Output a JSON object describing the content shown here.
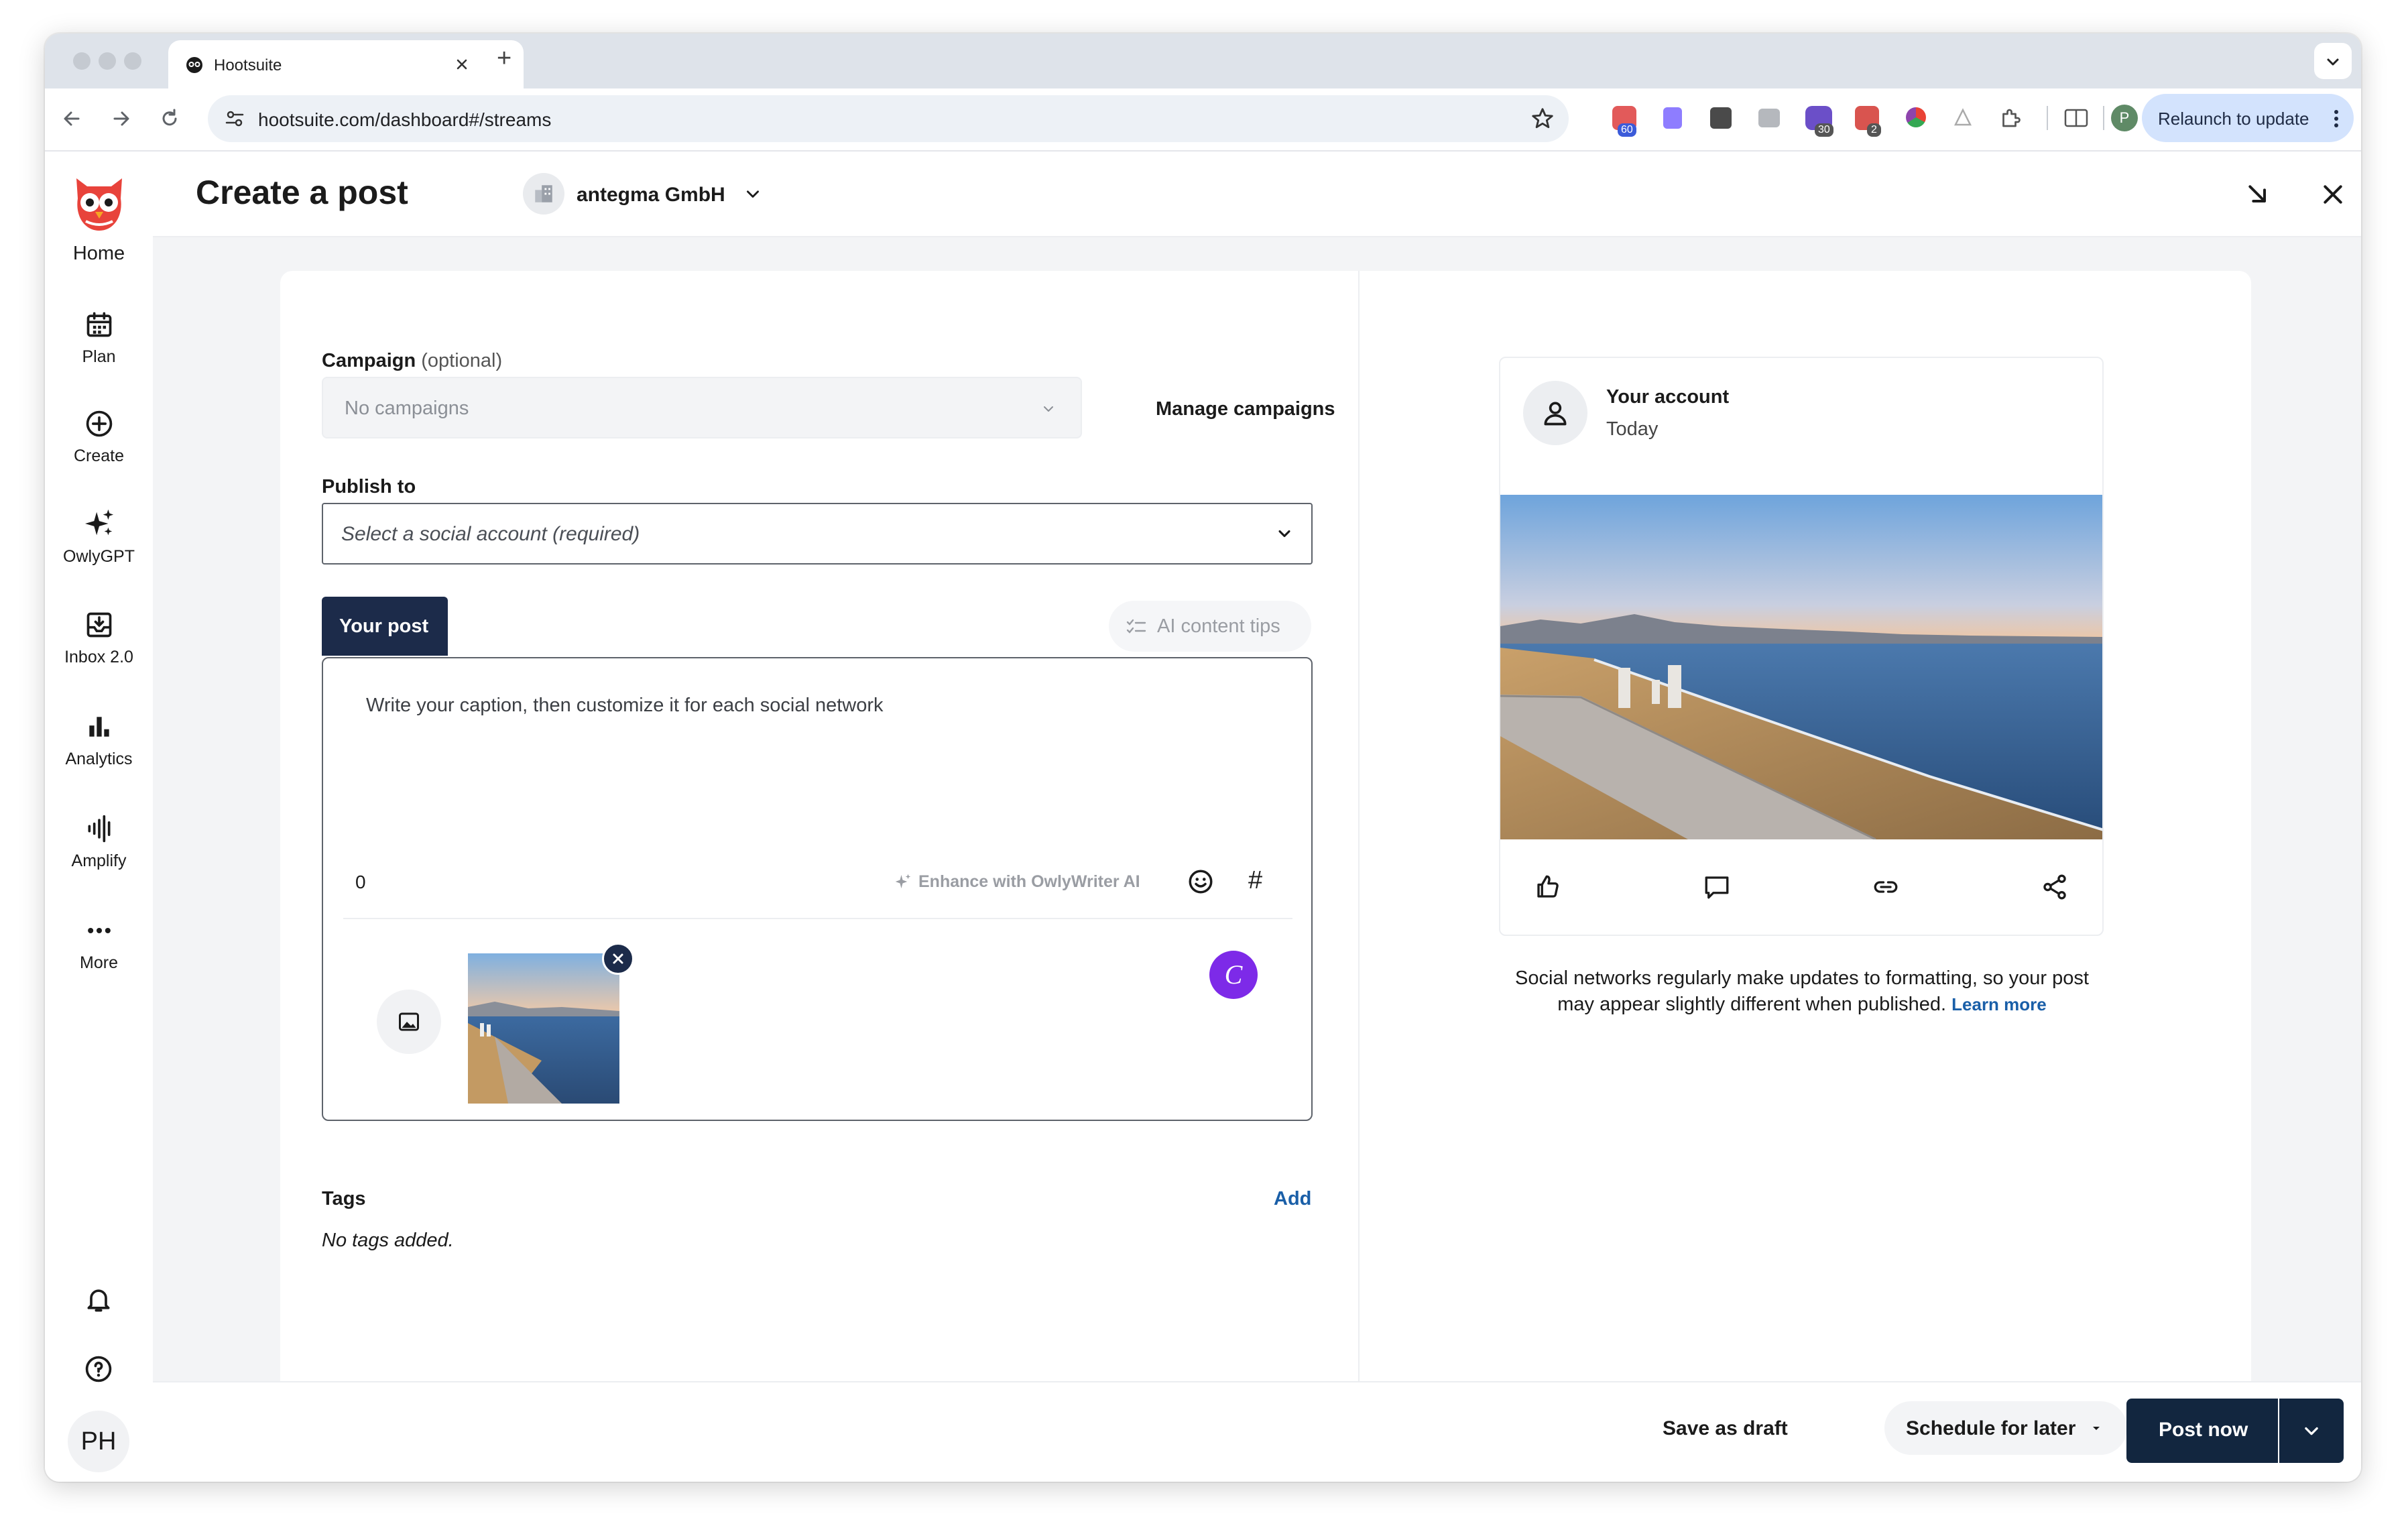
{
  "browser": {
    "tab_title": "Hootsuite",
    "new_tab": "+",
    "url": "hootsuite.com/dashboard#/streams",
    "relaunch_label": "Relaunch to update",
    "profile_initial": "P",
    "extension_badges": [
      "60",
      "30",
      "2"
    ]
  },
  "sidebar": {
    "home_label": "Home",
    "items": [
      {
        "label": "Plan",
        "icon": "calendar-icon"
      },
      {
        "label": "Create",
        "icon": "plus-circle-icon"
      },
      {
        "label": "OwlyGPT",
        "icon": "sparkle-icon"
      },
      {
        "label": "Inbox 2.0",
        "icon": "inbox-icon"
      },
      {
        "label": "Analytics",
        "icon": "bar-chart-icon"
      },
      {
        "label": "Amplify",
        "icon": "amplify-icon"
      },
      {
        "label": "More",
        "icon": "more-dots-icon"
      }
    ],
    "avatar_initials": "PH"
  },
  "header": {
    "title": "Create a post",
    "org_name": "antegma GmbH"
  },
  "form": {
    "campaign_label": "Campaign",
    "campaign_optional": "(optional)",
    "campaign_placeholder": "No campaigns",
    "manage_campaigns": "Manage campaigns",
    "publish_label": "Publish to",
    "publish_placeholder": "Select a social account (required)",
    "your_post_tab": "Your post",
    "ai_tips": "AI content tips",
    "caption_placeholder": "Write your caption, then customize it for each social network",
    "char_count": "0",
    "enhance_label": "Enhance with OwlyWriter AI",
    "hashtag": "#",
    "canva_letter": "C",
    "tags_label": "Tags",
    "tags_add": "Add",
    "tags_empty": "No tags added."
  },
  "preview": {
    "account_name": "Your account",
    "date": "Today",
    "note": "Social networks regularly make updates to formatting, so your post may appear slightly different when published.",
    "learn_more": "Learn more"
  },
  "footer": {
    "save_draft": "Save as draft",
    "schedule_later": "Schedule for later",
    "post_now": "Post now"
  },
  "colors": {
    "brand_red": "#e8433b",
    "primary_navy": "#12263f",
    "link_blue": "#1a5fa8",
    "canva_purple": "#7d2ae8"
  }
}
